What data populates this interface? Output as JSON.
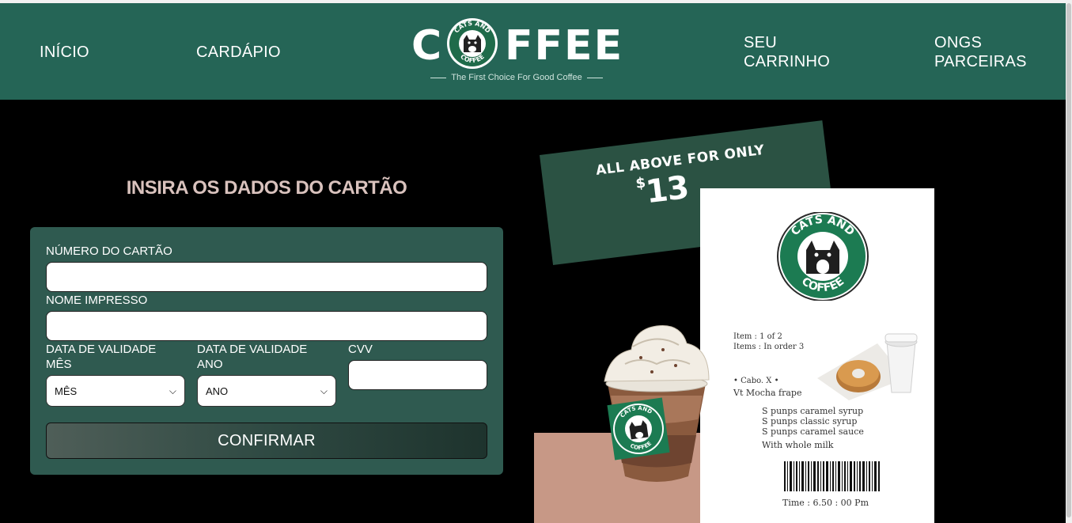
{
  "nav": {
    "inicio": "INÍCIO",
    "cardapio": "CARDÁPIO",
    "carrinho": "SEU CARRINHO",
    "ongs": "ONGS PARCEIRAS"
  },
  "logo": {
    "word_left": "C",
    "word_right": "FFEE",
    "badge_top": "CATS AND",
    "badge_bottom": "COFFEE",
    "tagline": "The First Choice For Good Coffee"
  },
  "form": {
    "title": "INSIRA OS DADOS DO CARTÃO",
    "card_number_label": "NÚMERO DO CARTÃO",
    "card_number_value": "",
    "name_label": "NOME IMPRESSO",
    "name_value": "",
    "month_label": "DATA DE VALIDADE MÊS",
    "month_selected": "MÊS",
    "year_label": "DATA DE VALIDADE ANO",
    "year_selected": "ANO",
    "cvv_label": "CVV",
    "cvv_value": "",
    "confirm_label": "CONFIRMAR"
  },
  "promo": {
    "line1": "ALL ABOVE FOR ONLY",
    "currency": "$",
    "price": "13"
  },
  "receipt": {
    "badge_top": "CATS AND",
    "badge_bottom": "COFFEE",
    "item": "Item : 1 of 2",
    "items": "Items : In order 3",
    "cabo": "• Cabo. X •",
    "product": "Vt Mocha frape",
    "l1": "S punps caramel syrup",
    "l2": "S punps classic syrup",
    "l3": "S punps caramel sauce",
    "l4": "With whole milk",
    "time": "Time : 6.50 : 00 Pm"
  },
  "cup": {
    "badge_top": "CATS AND",
    "badge_bottom": "COFFEE"
  },
  "colors": {
    "header_green": "#256556",
    "form_green": "#2f5a50",
    "title_pink": "#d9c2bd",
    "promo_green": "#2b5243",
    "beige": "#c79886"
  }
}
